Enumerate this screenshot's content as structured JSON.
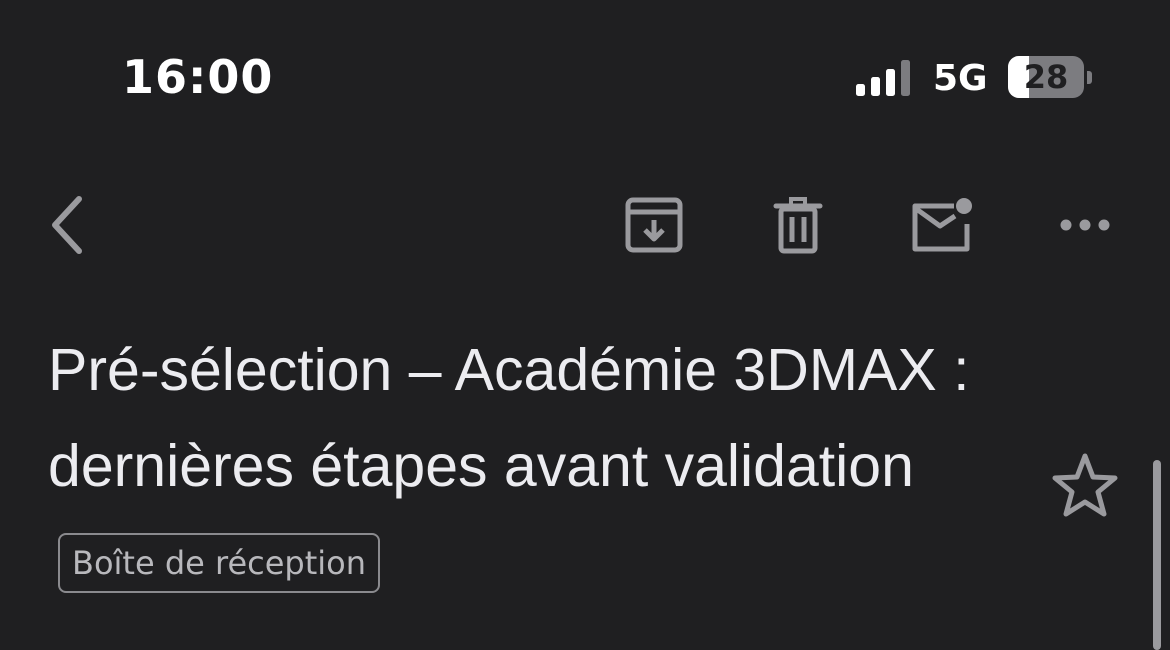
{
  "status_bar": {
    "time": "16:00",
    "network": "5G",
    "battery_level": "28",
    "battery_fraction": 0.28,
    "signal_icon": "cellular-signal-icon"
  },
  "toolbar": {
    "back_icon": "chevron-left-icon",
    "archive_icon": "archive-icon",
    "delete_icon": "trash-icon",
    "mark_unread_icon": "mail-unread-icon",
    "more_icon": "more-horizontal-icon"
  },
  "email": {
    "subject": "Pré-sélection – Académie 3DMAX : dernières étapes avant validation",
    "label": "Boîte de réception",
    "star_icon": "star-outline-icon"
  },
  "colors": {
    "background": "#1f1f21",
    "text": "#ececf0",
    "icon": "#9a9a9e"
  }
}
